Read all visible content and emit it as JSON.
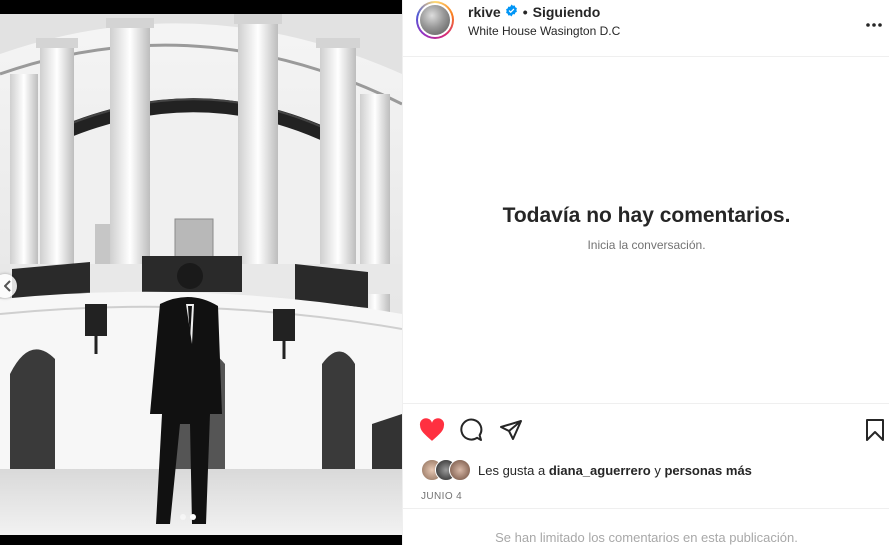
{
  "post": {
    "username": "rkive",
    "separator": "•",
    "follow_status": "Siguiendo",
    "location": "White House Wasington D.C",
    "more_icon": "more-horizontal-icon"
  },
  "comments": {
    "empty_title": "Todavía no hay comentarios.",
    "empty_subtitle": "Inicia la conversación."
  },
  "likes": {
    "prefix": "Les gusta a",
    "user": "diana_aguerrero",
    "conjunction": "y",
    "suffix": "personas más"
  },
  "date": "JUNIO 4",
  "footer": {
    "limited_text": "Se han limitado los comentarios en esta publicación."
  },
  "colors": {
    "like_red": "#ff3040",
    "verified_blue": "#0095f6",
    "text_primary": "#262626",
    "text_secondary": "#737373"
  },
  "carousel": {
    "dots": 2,
    "active_index": 1
  }
}
